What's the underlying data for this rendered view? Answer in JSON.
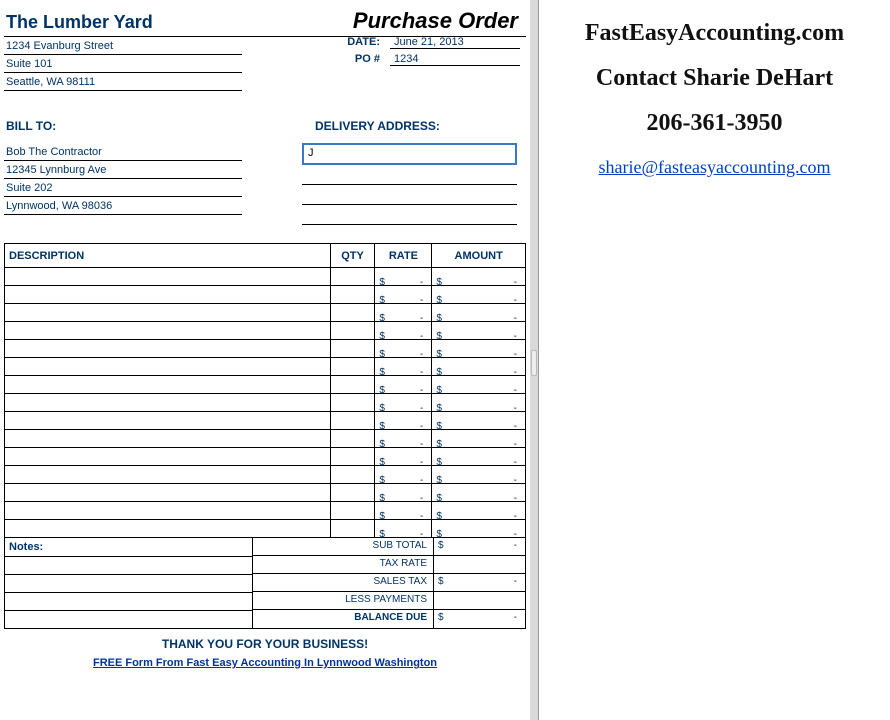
{
  "po": {
    "company_name": "The Lumber Yard",
    "title": "Purchase Order",
    "addr1": "1234 Evanburg Street",
    "addr2": "Suite 101",
    "addr3": "Seattle, WA 98111",
    "date_label": "DATE:",
    "date_value": "June 21, 2013",
    "ponum_label": "PO #",
    "ponum_value": "1234",
    "billto_label": "BILL TO:",
    "delivery_label": "DELIVERY ADDRESS:",
    "bill1": "Bob The Contractor",
    "bill2": "12345 Lynnburg Ave",
    "bill3": "Suite 202",
    "bill4": "Lynnwood, WA 98036",
    "delivery_input": "J",
    "col_desc": "DESCRIPTION",
    "col_qty": "QTY",
    "col_rate": "RATE",
    "col_amount": "AMOUNT",
    "cur": "$",
    "dash": "-",
    "notes_label": "Notes:",
    "subtotal": "SUB TOTAL",
    "taxrate": "TAX RATE",
    "salestax": "SALES TAX",
    "lesspay": "LESS PAYMENTS",
    "balance": "BALANCE DUE",
    "thanks": "THANK YOU FOR YOUR BUSINESS!",
    "footer_link": "FREE Form From Fast Easy Accounting In Lynnwood Washington"
  },
  "promo": {
    "site": "FastEasyAccounting.com",
    "contact": "Contact Sharie DeHart",
    "phone": "206-361-3950",
    "email": "sharie@fasteasyaccounting.com"
  }
}
